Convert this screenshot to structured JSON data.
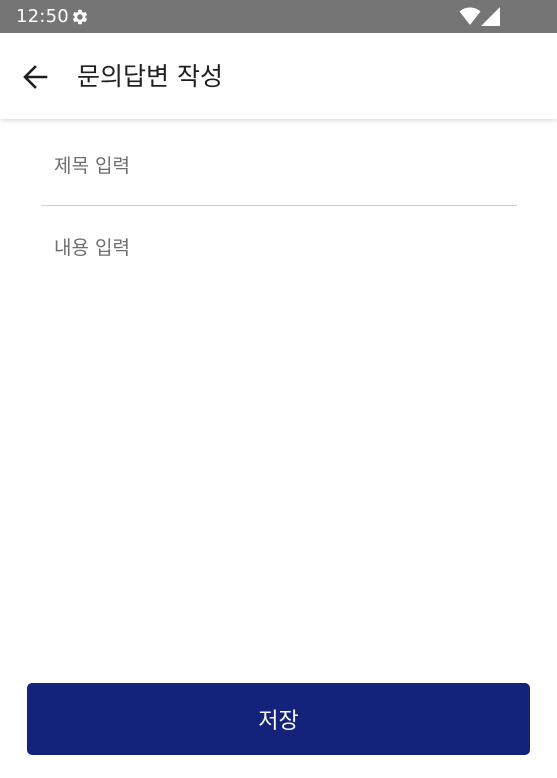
{
  "status_bar": {
    "time": "12:50",
    "icons": [
      "gear-icon",
      "wifi-icon",
      "cellular-signal-icon"
    ],
    "background_color": "#757575"
  },
  "app_bar": {
    "back_icon": "arrow-left-icon",
    "title": "문의답변 작성"
  },
  "form": {
    "title_placeholder": "제목 입력",
    "title_value": "",
    "content_placeholder": "내용 입력",
    "content_value": ""
  },
  "save_button": {
    "label": "저장",
    "color": "#13227a"
  }
}
